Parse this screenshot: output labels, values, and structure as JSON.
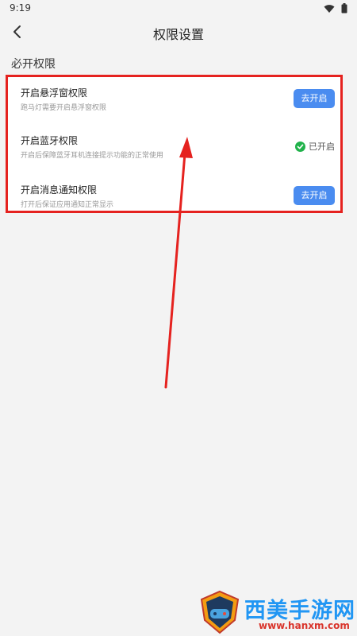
{
  "status_bar": {
    "time": "9:19"
  },
  "nav": {
    "title": "权限设置"
  },
  "section": {
    "title": "必开权限"
  },
  "permissions": [
    {
      "title": "开启悬浮窗权限",
      "desc": "跑马灯需要开启悬浮窗权限",
      "action": "去开启"
    },
    {
      "title": "开启蓝牙权限",
      "desc": "开启后保障蓝牙耳机连接提示功能的正常使用",
      "status": "已开启"
    },
    {
      "title": "开启消息通知权限",
      "desc": "打开后保证应用通知正常显示",
      "action": "去开启"
    }
  ],
  "watermark": {
    "brand": "西美手游网",
    "url": "www.hanxm.com"
  },
  "colors": {
    "button": "#4a8cf0",
    "highlight": "#e5221f",
    "check": "#21b24b",
    "watermark": "#2196f3"
  }
}
